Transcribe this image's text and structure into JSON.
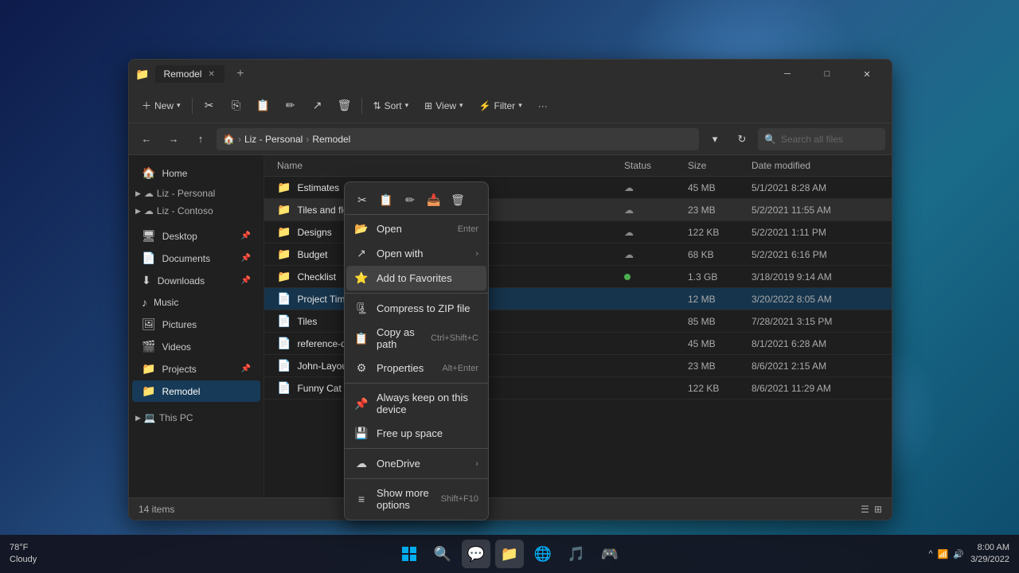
{
  "desktop": {
    "bg": "#1a3a6b"
  },
  "taskbar": {
    "weather": "78°F",
    "weather_condition": "Cloudy",
    "time": "8:00 AM",
    "date": "3/29/2022",
    "start_label": "⊞",
    "search_label": "🔍",
    "icons": [
      "⊞",
      "🔍",
      "💬",
      "📁",
      "🌐",
      "🎵"
    ]
  },
  "window": {
    "title": "Remodel",
    "icon": "📁",
    "tab_label": "Remodel",
    "close": "✕",
    "minimize": "─",
    "maximize": "□"
  },
  "toolbar": {
    "new_label": "New",
    "sort_label": "Sort",
    "view_label": "View",
    "filter_label": "Filter",
    "more_label": "···"
  },
  "addressbar": {
    "breadcrumb_home": "🏠",
    "breadcrumb_liz": "Liz - Personal",
    "breadcrumb_remodel": "Remodel",
    "search_placeholder": "Search all files"
  },
  "sidebar": {
    "home_label": "Home",
    "groups": [
      {
        "label": "Liz - Personal",
        "icon": "☁"
      },
      {
        "label": "Liz - Contoso",
        "icon": "☁"
      }
    ],
    "items": [
      {
        "label": "Desktop",
        "icon": "🖥",
        "pinned": true
      },
      {
        "label": "Documents",
        "icon": "📄",
        "pinned": true
      },
      {
        "label": "Downloads",
        "icon": "⬇",
        "pinned": true
      },
      {
        "label": "Music",
        "icon": "♪",
        "pinned": false
      },
      {
        "label": "Pictures",
        "icon": "🖼",
        "pinned": false
      },
      {
        "label": "Videos",
        "icon": "🎬",
        "pinned": false
      },
      {
        "label": "Projects",
        "icon": "📁",
        "pinned": true
      },
      {
        "label": "Remodel",
        "icon": "📁",
        "pinned": false,
        "selected": true
      }
    ],
    "this_pc_label": "This PC",
    "this_pc_icon": "💻"
  },
  "file_list": {
    "headers": [
      "Name",
      "Status",
      "Size",
      "Date modified"
    ],
    "files": [
      {
        "name": "Estimates",
        "type": "folder",
        "status": "cloud",
        "size": "45 MB",
        "date": "5/1/2021 8:28 AM"
      },
      {
        "name": "Tiles and flooring",
        "type": "folder",
        "status": "cloud",
        "size": "23 MB",
        "date": "5/2/2021 11:55 AM",
        "highlighted": true
      },
      {
        "name": "Designs",
        "type": "folder",
        "status": "cloud",
        "size": "122 KB",
        "date": "5/2/2021 1:11 PM"
      },
      {
        "name": "Budget",
        "type": "folder",
        "status": "cloud",
        "size": "68 KB",
        "date": "5/2/2021 6:16 PM"
      },
      {
        "name": "Checklist",
        "type": "folder",
        "status": "green",
        "size": "1.3 GB",
        "date": "3/18/2019 9:14 AM"
      },
      {
        "name": "Project Timeline",
        "type": "file",
        "status": "",
        "size": "12 MB",
        "date": "3/20/2022 8:05 AM",
        "selected": true
      },
      {
        "name": "Tiles",
        "type": "file",
        "status": "",
        "size": "85 MB",
        "date": "7/28/2021 3:15 PM"
      },
      {
        "name": "reference-diag...",
        "type": "file",
        "status": "",
        "size": "45 MB",
        "date": "8/1/2021 6:28 AM"
      },
      {
        "name": "John-Layout",
        "type": "file",
        "status": "",
        "size": "23 MB",
        "date": "8/6/2021 2:15 AM"
      },
      {
        "name": "Funny Cat Pictu...",
        "type": "file",
        "status": "",
        "size": "122 KB",
        "date": "8/6/2021 11:29 AM"
      }
    ]
  },
  "context_menu": {
    "toolbar_icons": [
      "✂",
      "📋",
      "✏",
      "📥",
      "🗑"
    ],
    "items": [
      {
        "icon": "📂",
        "label": "Open",
        "shortcut": "Enter",
        "type": "item"
      },
      {
        "icon": "↗",
        "label": "Open with",
        "arrow": "›",
        "type": "item"
      },
      {
        "icon": "⭐",
        "label": "Add to Favorites",
        "type": "item",
        "active": true
      },
      {
        "type": "sep"
      },
      {
        "icon": "🗜",
        "label": "Compress to ZIP file",
        "type": "item"
      },
      {
        "icon": "📋",
        "label": "Copy as path",
        "shortcut": "Ctrl+Shift+C",
        "type": "item"
      },
      {
        "icon": "⚙",
        "label": "Properties",
        "shortcut": "Alt+Enter",
        "type": "item"
      },
      {
        "type": "sep"
      },
      {
        "icon": "📌",
        "label": "Always keep on this device",
        "type": "item"
      },
      {
        "icon": "💾",
        "label": "Free up space",
        "type": "item"
      },
      {
        "type": "sep"
      },
      {
        "icon": "☁",
        "label": "OneDrive",
        "arrow": "›",
        "type": "item"
      },
      {
        "type": "sep"
      },
      {
        "icon": "≡",
        "label": "Show more options",
        "shortcut": "Shift+F10",
        "type": "item"
      }
    ]
  },
  "status_bar": {
    "count": "14 items",
    "view_icons": [
      "☰",
      "⊞"
    ]
  }
}
